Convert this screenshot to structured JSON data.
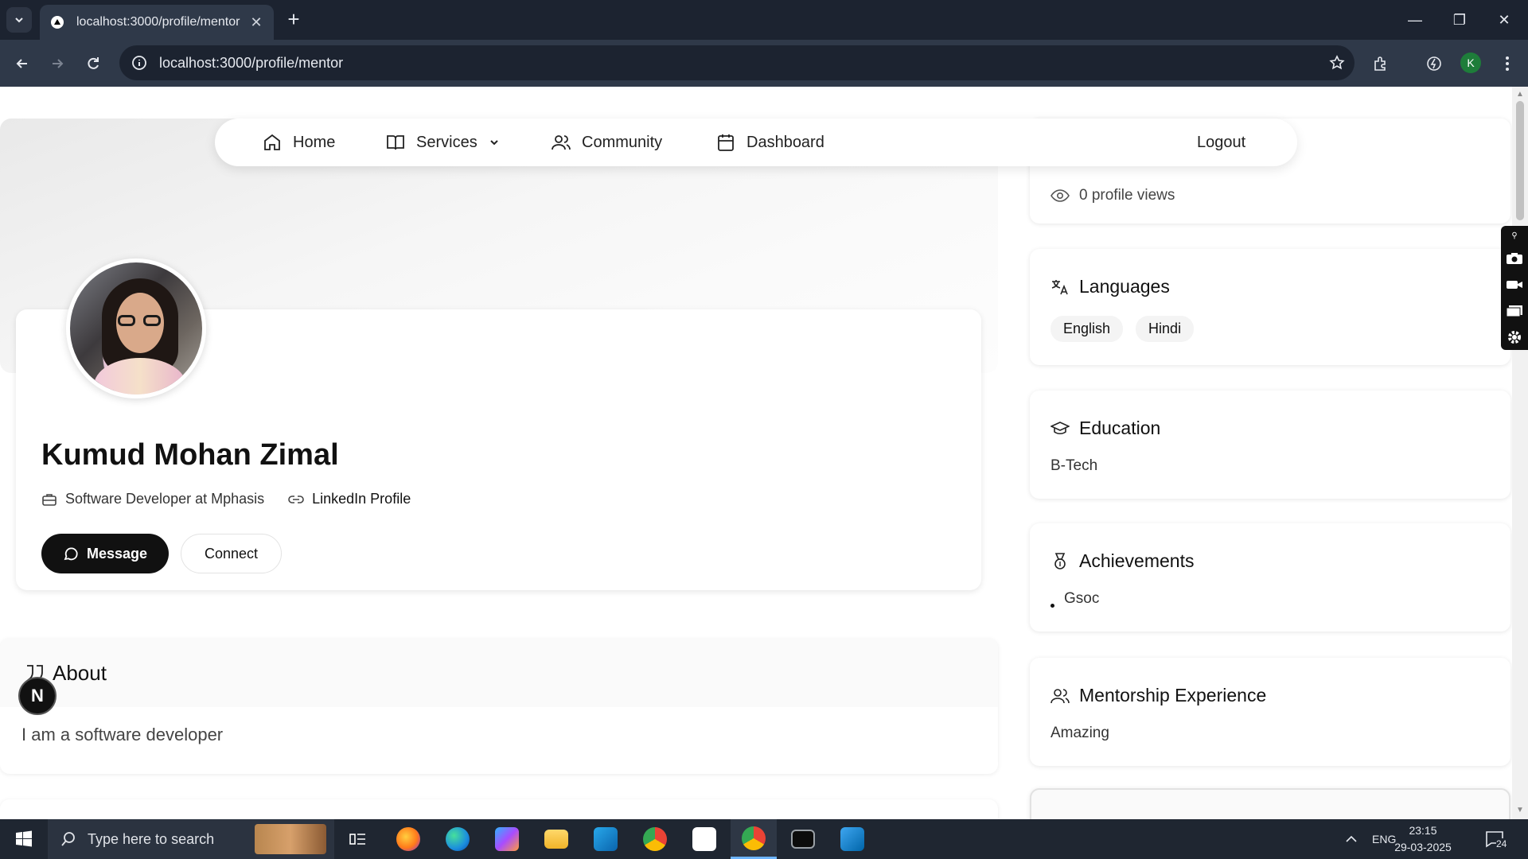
{
  "browser": {
    "tab_title": "localhost:3000/profile/mentor",
    "url": "localhost:3000/profile/mentor",
    "profile_initial": "K"
  },
  "navbar": {
    "home": "Home",
    "services": "Services",
    "community": "Community",
    "dashboard": "Dashboard",
    "logout": "Logout"
  },
  "profile": {
    "name": "Kumud Mohan Zimal",
    "role": "Software Developer at Mphasis",
    "linkedin": "LinkedIn Profile",
    "message_label": "Message",
    "connect_label": "Connect"
  },
  "about": {
    "title": "About",
    "text": "I am a software developer"
  },
  "sidebar": {
    "profile_views": "0 profile views",
    "languages": {
      "title": "Languages",
      "items": [
        "English",
        "Hindi"
      ]
    },
    "education": {
      "title": "Education",
      "value": "B-Tech"
    },
    "achievements": {
      "title": "Achievements",
      "items": [
        "Gsoc"
      ]
    },
    "mentorship": {
      "title": "Mentorship Experience",
      "value": "Amazing"
    }
  },
  "nextjs_badge": "N",
  "taskbar": {
    "search_placeholder": "Type here to search",
    "language": "ENG",
    "time": "23:15",
    "date": "29-03-2025",
    "notifications": "24"
  }
}
